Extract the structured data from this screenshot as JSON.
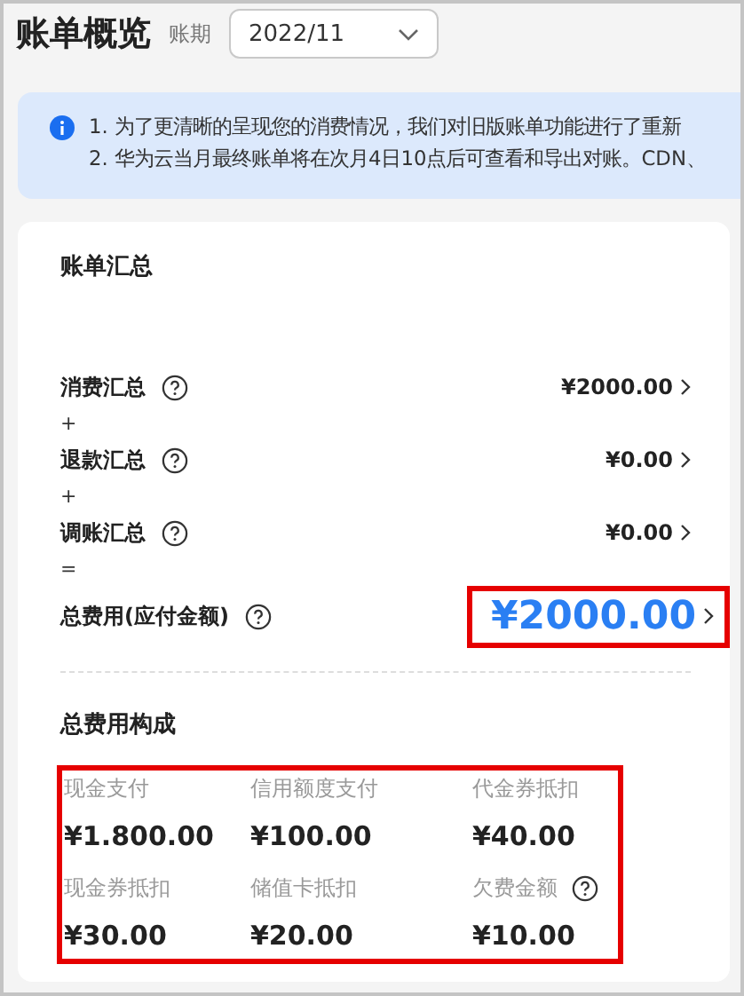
{
  "header": {
    "title": "账单概览",
    "period_label": "账期",
    "period_select": {
      "value": "2022/11"
    }
  },
  "notice": {
    "lines": [
      "1. 为了更清晰的呈现您的消费情况，我们对旧版账单功能进行了重新",
      "2. 华为云当月最终账单将在次月4日10点后可查看和导出对账。CDN、"
    ]
  },
  "summary": {
    "title": "账单汇总",
    "rows": [
      {
        "label": "消费汇总",
        "amount": "¥2000.00",
        "operator": "+"
      },
      {
        "label": "退款汇总",
        "amount": "¥0.00",
        "operator": "+"
      },
      {
        "label": "调账汇总",
        "amount": "¥0.00",
        "operator": "="
      }
    ],
    "total": {
      "label": "总费用(应付金额)",
      "amount": "¥2000.00",
      "highlighted": true
    }
  },
  "composition": {
    "title": "总费用构成",
    "highlighted": true,
    "items": [
      {
        "label": "现金支付",
        "amount": "¥1.800.00",
        "help": false
      },
      {
        "label": "信用额度支付",
        "amount": "¥100.00",
        "help": false
      },
      {
        "label": "代金券抵扣",
        "amount": "¥40.00",
        "help": false
      },
      {
        "label": "现金券抵扣",
        "amount": "¥30.00",
        "help": false
      },
      {
        "label": "储值卡抵扣",
        "amount": "¥20.00",
        "help": false
      },
      {
        "label": "欠费金额",
        "amount": "¥10.00",
        "help": true
      }
    ]
  }
}
